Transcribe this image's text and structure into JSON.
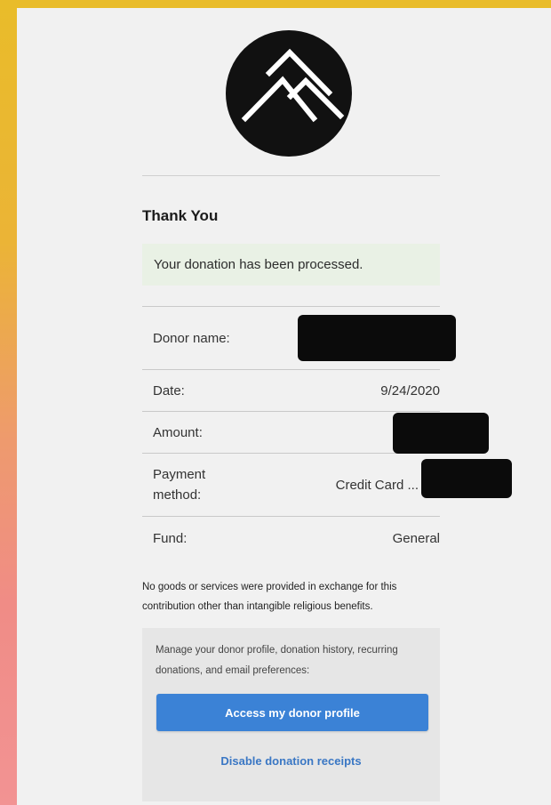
{
  "logo": {
    "icon": "mountain-logo-icon"
  },
  "heading": "Thank You",
  "notice": "Your donation has been processed.",
  "details": {
    "donor_name_label": "Donor name:",
    "date_label": "Date:",
    "date_value": "9/24/2020",
    "amount_label": "Amount:",
    "payment_label_line1": "Payment",
    "payment_label_line2": "method:",
    "payment_value": "Credit Card ...",
    "fund_label": "Fund:",
    "fund_value": "General"
  },
  "disclaimer": "No goods or services were provided in exchange for this contribution other than intangible religious benefits.",
  "manage": {
    "text": "Manage your donor profile, donation history, recurring donations, and email preferences:",
    "button_label": "Access my donor profile",
    "link_label": "Disable donation receipts"
  },
  "colors": {
    "accent": "#3B82D6",
    "link": "#3A77C4",
    "notice_bg": "#E9F1E5",
    "background_top": "#E9BC2A",
    "background_bottom": "#F29393"
  }
}
